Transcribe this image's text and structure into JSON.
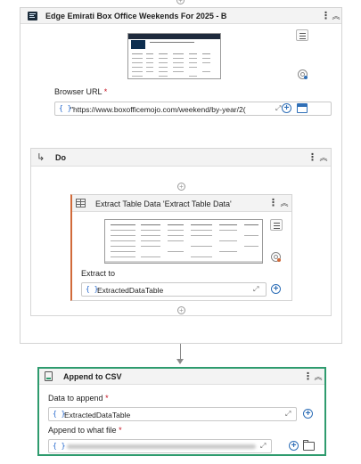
{
  "browser_card": {
    "title": "Edge Emirati Box Office Weekends For 2025 - B",
    "url_label": "Browser URL",
    "required_mark": "*",
    "url_value": "\"https://www.boxofficemojo.com/weekend/by-year/2("
  },
  "do_block": {
    "title": "Do"
  },
  "extract_card": {
    "title": "Extract Table Data 'Extract Table Data'",
    "extract_to_label": "Extract to",
    "extract_to_value": "ExtractedDataTable"
  },
  "csv_card": {
    "title": "Append to CSV",
    "data_label": "Data to append",
    "data_value": "ExtractedDataTable",
    "file_label": "Append to what file",
    "required_mark": "*"
  },
  "icons": {
    "brace": "{ }",
    "kebab": "⋮",
    "collapse": "︽",
    "plus": "+",
    "do_arrow": "↳",
    "expand": "⤢"
  },
  "colors": {
    "csv_border": "#2e9b6e",
    "accent_blue": "#2f6fb7",
    "required_red": "#c50f1f",
    "header_bar": "#f3f3f3"
  }
}
